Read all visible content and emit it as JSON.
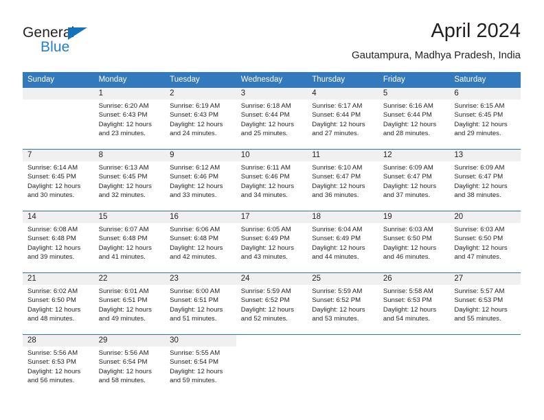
{
  "brand": {
    "name_part1": "General",
    "name_part2": "Blue",
    "triangle_color": "#1273bd",
    "blue_color": "#1f7fd0"
  },
  "header": {
    "month_title": "April 2024",
    "location": "Gautampura, Madhya Pradesh, India"
  },
  "theme": {
    "header_row_bg": "#3379bd",
    "week_separator": "#2e75b6",
    "daynum_band_bg": "#f0f0f0",
    "text_color": "#231f20"
  },
  "calendar": {
    "weekday_headers": [
      "Sunday",
      "Monday",
      "Tuesday",
      "Wednesday",
      "Thursday",
      "Friday",
      "Saturday"
    ],
    "weeks": [
      [
        {
          "day": "",
          "sunrise": "",
          "sunset": "",
          "daylight_line1": "",
          "daylight_line2": ""
        },
        {
          "day": "1",
          "sunrise": "Sunrise: 6:20 AM",
          "sunset": "Sunset: 6:43 PM",
          "daylight_line1": "Daylight: 12 hours",
          "daylight_line2": "and 23 minutes."
        },
        {
          "day": "2",
          "sunrise": "Sunrise: 6:19 AM",
          "sunset": "Sunset: 6:43 PM",
          "daylight_line1": "Daylight: 12 hours",
          "daylight_line2": "and 24 minutes."
        },
        {
          "day": "3",
          "sunrise": "Sunrise: 6:18 AM",
          "sunset": "Sunset: 6:44 PM",
          "daylight_line1": "Daylight: 12 hours",
          "daylight_line2": "and 25 minutes."
        },
        {
          "day": "4",
          "sunrise": "Sunrise: 6:17 AM",
          "sunset": "Sunset: 6:44 PM",
          "daylight_line1": "Daylight: 12 hours",
          "daylight_line2": "and 27 minutes."
        },
        {
          "day": "5",
          "sunrise": "Sunrise: 6:16 AM",
          "sunset": "Sunset: 6:44 PM",
          "daylight_line1": "Daylight: 12 hours",
          "daylight_line2": "and 28 minutes."
        },
        {
          "day": "6",
          "sunrise": "Sunrise: 6:15 AM",
          "sunset": "Sunset: 6:45 PM",
          "daylight_line1": "Daylight: 12 hours",
          "daylight_line2": "and 29 minutes."
        }
      ],
      [
        {
          "day": "7",
          "sunrise": "Sunrise: 6:14 AM",
          "sunset": "Sunset: 6:45 PM",
          "daylight_line1": "Daylight: 12 hours",
          "daylight_line2": "and 30 minutes."
        },
        {
          "day": "8",
          "sunrise": "Sunrise: 6:13 AM",
          "sunset": "Sunset: 6:45 PM",
          "daylight_line1": "Daylight: 12 hours",
          "daylight_line2": "and 32 minutes."
        },
        {
          "day": "9",
          "sunrise": "Sunrise: 6:12 AM",
          "sunset": "Sunset: 6:46 PM",
          "daylight_line1": "Daylight: 12 hours",
          "daylight_line2": "and 33 minutes."
        },
        {
          "day": "10",
          "sunrise": "Sunrise: 6:11 AM",
          "sunset": "Sunset: 6:46 PM",
          "daylight_line1": "Daylight: 12 hours",
          "daylight_line2": "and 34 minutes."
        },
        {
          "day": "11",
          "sunrise": "Sunrise: 6:10 AM",
          "sunset": "Sunset: 6:47 PM",
          "daylight_line1": "Daylight: 12 hours",
          "daylight_line2": "and 36 minutes."
        },
        {
          "day": "12",
          "sunrise": "Sunrise: 6:09 AM",
          "sunset": "Sunset: 6:47 PM",
          "daylight_line1": "Daylight: 12 hours",
          "daylight_line2": "and 37 minutes."
        },
        {
          "day": "13",
          "sunrise": "Sunrise: 6:09 AM",
          "sunset": "Sunset: 6:47 PM",
          "daylight_line1": "Daylight: 12 hours",
          "daylight_line2": "and 38 minutes."
        }
      ],
      [
        {
          "day": "14",
          "sunrise": "Sunrise: 6:08 AM",
          "sunset": "Sunset: 6:48 PM",
          "daylight_line1": "Daylight: 12 hours",
          "daylight_line2": "and 39 minutes."
        },
        {
          "day": "15",
          "sunrise": "Sunrise: 6:07 AM",
          "sunset": "Sunset: 6:48 PM",
          "daylight_line1": "Daylight: 12 hours",
          "daylight_line2": "and 41 minutes."
        },
        {
          "day": "16",
          "sunrise": "Sunrise: 6:06 AM",
          "sunset": "Sunset: 6:48 PM",
          "daylight_line1": "Daylight: 12 hours",
          "daylight_line2": "and 42 minutes."
        },
        {
          "day": "17",
          "sunrise": "Sunrise: 6:05 AM",
          "sunset": "Sunset: 6:49 PM",
          "daylight_line1": "Daylight: 12 hours",
          "daylight_line2": "and 43 minutes."
        },
        {
          "day": "18",
          "sunrise": "Sunrise: 6:04 AM",
          "sunset": "Sunset: 6:49 PM",
          "daylight_line1": "Daylight: 12 hours",
          "daylight_line2": "and 44 minutes."
        },
        {
          "day": "19",
          "sunrise": "Sunrise: 6:03 AM",
          "sunset": "Sunset: 6:50 PM",
          "daylight_line1": "Daylight: 12 hours",
          "daylight_line2": "and 46 minutes."
        },
        {
          "day": "20",
          "sunrise": "Sunrise: 6:03 AM",
          "sunset": "Sunset: 6:50 PM",
          "daylight_line1": "Daylight: 12 hours",
          "daylight_line2": "and 47 minutes."
        }
      ],
      [
        {
          "day": "21",
          "sunrise": "Sunrise: 6:02 AM",
          "sunset": "Sunset: 6:50 PM",
          "daylight_line1": "Daylight: 12 hours",
          "daylight_line2": "and 48 minutes."
        },
        {
          "day": "22",
          "sunrise": "Sunrise: 6:01 AM",
          "sunset": "Sunset: 6:51 PM",
          "daylight_line1": "Daylight: 12 hours",
          "daylight_line2": "and 49 minutes."
        },
        {
          "day": "23",
          "sunrise": "Sunrise: 6:00 AM",
          "sunset": "Sunset: 6:51 PM",
          "daylight_line1": "Daylight: 12 hours",
          "daylight_line2": "and 51 minutes."
        },
        {
          "day": "24",
          "sunrise": "Sunrise: 5:59 AM",
          "sunset": "Sunset: 6:52 PM",
          "daylight_line1": "Daylight: 12 hours",
          "daylight_line2": "and 52 minutes."
        },
        {
          "day": "25",
          "sunrise": "Sunrise: 5:59 AM",
          "sunset": "Sunset: 6:52 PM",
          "daylight_line1": "Daylight: 12 hours",
          "daylight_line2": "and 53 minutes."
        },
        {
          "day": "26",
          "sunrise": "Sunrise: 5:58 AM",
          "sunset": "Sunset: 6:53 PM",
          "daylight_line1": "Daylight: 12 hours",
          "daylight_line2": "and 54 minutes."
        },
        {
          "day": "27",
          "sunrise": "Sunrise: 5:57 AM",
          "sunset": "Sunset: 6:53 PM",
          "daylight_line1": "Daylight: 12 hours",
          "daylight_line2": "and 55 minutes."
        }
      ],
      [
        {
          "day": "28",
          "sunrise": "Sunrise: 5:56 AM",
          "sunset": "Sunset: 6:53 PM",
          "daylight_line1": "Daylight: 12 hours",
          "daylight_line2": "and 56 minutes."
        },
        {
          "day": "29",
          "sunrise": "Sunrise: 5:56 AM",
          "sunset": "Sunset: 6:54 PM",
          "daylight_line1": "Daylight: 12 hours",
          "daylight_line2": "and 58 minutes."
        },
        {
          "day": "30",
          "sunrise": "Sunrise: 5:55 AM",
          "sunset": "Sunset: 6:54 PM",
          "daylight_line1": "Daylight: 12 hours",
          "daylight_line2": "and 59 minutes."
        },
        {
          "day": "",
          "sunrise": "",
          "sunset": "",
          "daylight_line1": "",
          "daylight_line2": ""
        },
        {
          "day": "",
          "sunrise": "",
          "sunset": "",
          "daylight_line1": "",
          "daylight_line2": ""
        },
        {
          "day": "",
          "sunrise": "",
          "sunset": "",
          "daylight_line1": "",
          "daylight_line2": ""
        },
        {
          "day": "",
          "sunrise": "",
          "sunset": "",
          "daylight_line1": "",
          "daylight_line2": ""
        }
      ]
    ]
  }
}
